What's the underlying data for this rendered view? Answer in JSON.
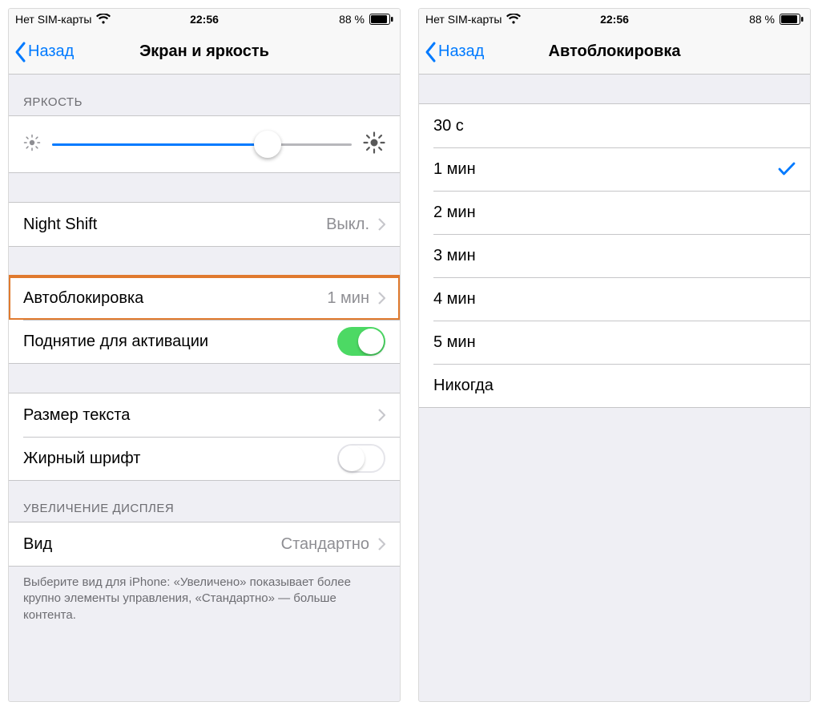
{
  "status": {
    "carrier": "Нет SIM-карты",
    "time": "22:56",
    "battery_pct": "88 %"
  },
  "left": {
    "back_label": "Назад",
    "title": "Экран и яркость",
    "brightness_header": "ЯРКОСТЬ",
    "brightness_value_pct": 72,
    "rows": {
      "night_shift": {
        "label": "Night Shift",
        "value": "Выкл."
      },
      "auto_lock": {
        "label": "Автоблокировка",
        "value": "1 мин"
      },
      "raise_wake": {
        "label": "Поднятие для активации",
        "on": true
      },
      "text_size": {
        "label": "Размер текста"
      },
      "bold_text": {
        "label": "Жирный шрифт",
        "on": false
      }
    },
    "zoom_header": "УВЕЛИЧЕНИЕ ДИСПЛЕЯ",
    "view_row": {
      "label": "Вид",
      "value": "Стандартно"
    },
    "footer": "Выберите вид для iPhone: «Увеличено» показывает более крупно элементы управления, «Стандартно» — больше контента."
  },
  "right": {
    "back_label": "Назад",
    "title": "Автоблокировка",
    "options": [
      {
        "label": "30 с",
        "selected": false
      },
      {
        "label": "1 мин",
        "selected": true
      },
      {
        "label": "2 мин",
        "selected": false
      },
      {
        "label": "3 мин",
        "selected": false
      },
      {
        "label": "4 мин",
        "selected": false
      },
      {
        "label": "5 мин",
        "selected": false
      },
      {
        "label": "Никогда",
        "selected": false
      }
    ]
  }
}
